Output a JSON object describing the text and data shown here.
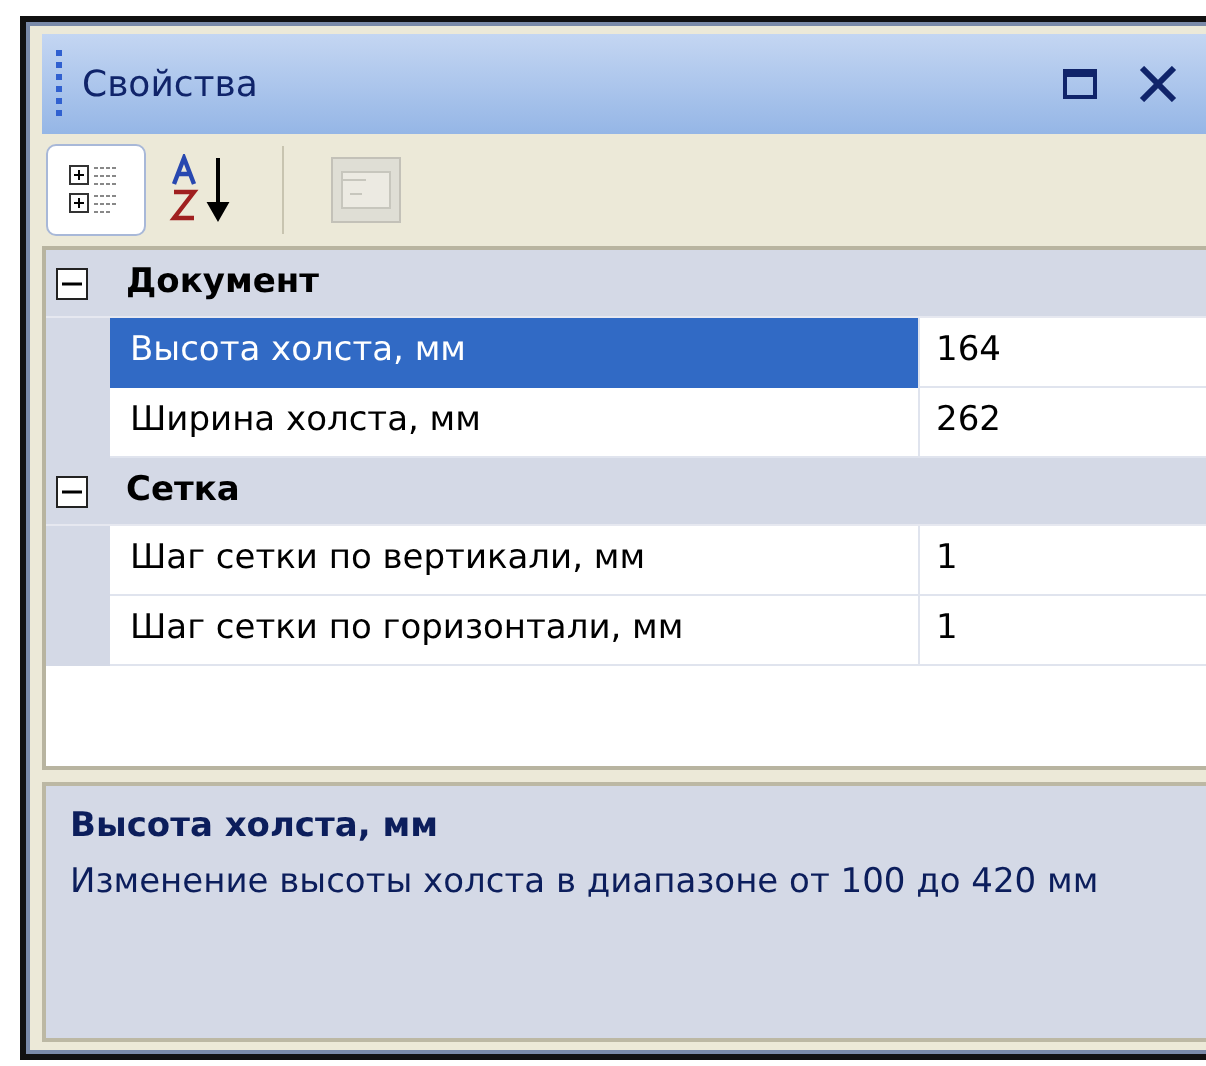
{
  "window": {
    "title": "Свойства"
  },
  "toolbar": [
    {
      "kind": "categorized",
      "selected": true,
      "disabled": false
    },
    {
      "kind": "alphabetical",
      "selected": false,
      "disabled": false
    },
    {
      "kind": "separator"
    },
    {
      "kind": "pages",
      "selected": false,
      "disabled": true
    }
  ],
  "grid": {
    "categories": [
      {
        "name": "Документ",
        "expanded": true,
        "properties": [
          {
            "name": "Высота холста, мм",
            "value": "164",
            "selected": true
          },
          {
            "name": "Ширина холста, мм",
            "value": "262",
            "selected": false
          }
        ]
      },
      {
        "name": "Сетка",
        "expanded": true,
        "properties": [
          {
            "name": "Шаг сетки по вертикали, мм",
            "value": "1",
            "selected": false
          },
          {
            "name": "Шаг сетки по горизонтали, мм",
            "value": "1",
            "selected": false
          }
        ]
      }
    ]
  },
  "description": {
    "title": "Высота холста, мм",
    "text": "Изменение высоты холста в диапазоне от 100 до 420 мм"
  }
}
